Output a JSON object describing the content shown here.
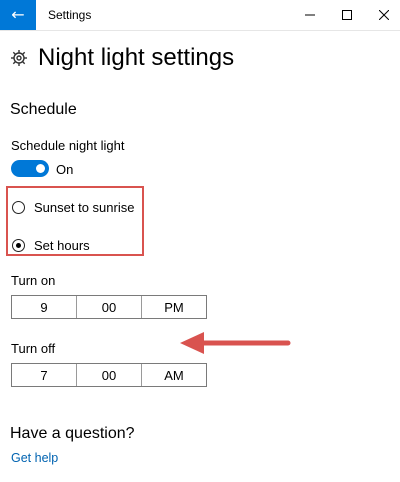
{
  "window": {
    "title": "Settings",
    "back_icon": "arrow-left-icon",
    "controls": [
      "minimize-icon",
      "maximize-icon",
      "close-icon"
    ]
  },
  "page": {
    "title": "Night light settings",
    "title_icon": "gear-icon"
  },
  "schedule": {
    "heading": "Schedule",
    "toggle_label": "Schedule night light",
    "toggle_state": "On",
    "toggle_on": true,
    "options": [
      {
        "label": "Sunset to sunrise",
        "selected": false
      },
      {
        "label": "Set hours",
        "selected": true
      }
    ]
  },
  "turn_on": {
    "label": "Turn on",
    "hour": "9",
    "minute": "00",
    "period": "PM"
  },
  "turn_off": {
    "label": "Turn off",
    "hour": "7",
    "minute": "00",
    "period": "AM"
  },
  "help": {
    "heading": "Have a question?",
    "link": "Get help"
  },
  "colors": {
    "accent": "#0078d7",
    "annotation": "#d9534f",
    "link": "#0063b1"
  }
}
